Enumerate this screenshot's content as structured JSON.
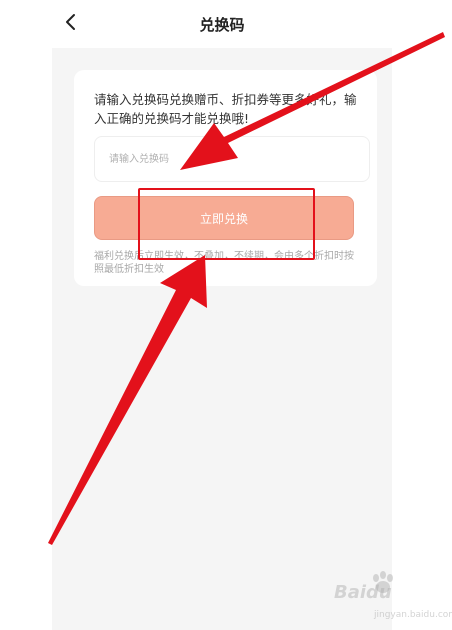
{
  "header": {
    "title": "兑换码"
  },
  "card": {
    "description": "请输入兑换码兑换赠币、折扣券等更多好礼，输入正确的兑换码才能兑换哦!",
    "input_placeholder": "请输入兑换码",
    "input_value": "",
    "redeem_label": "立即兑换",
    "note": "福利兑换后立即生效，不叠加，不续期，会由多个折扣时按照最低折扣生效"
  },
  "annotation": {
    "arrow_color": "#e3111b",
    "box_color": "#e3111b"
  },
  "watermark": {
    "brand": "Baidu",
    "sub": "jingyan.baidu.com"
  },
  "colors": {
    "redeem_button": "#f7ab94",
    "page_background": "#f5f5f5"
  }
}
